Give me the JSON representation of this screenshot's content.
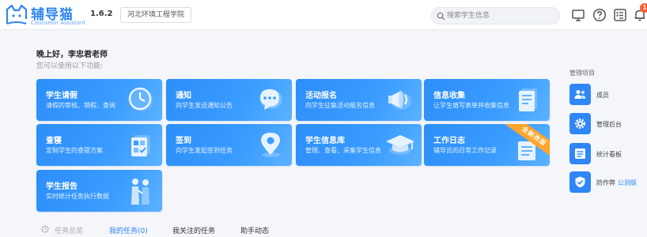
{
  "header": {
    "logo_title": "辅导猫",
    "logo_subtitle": "Counselor Assistant",
    "version": "1.6.2",
    "school": "河北环境工程学院",
    "search_placeholder": "搜索学生信息",
    "notification_count": "1"
  },
  "greeting": {
    "title": "晚上好，李忠君老师",
    "subtitle": "您可以使用以下功能:"
  },
  "cards": [
    {
      "title": "学生请假",
      "desc": "请假的审核、销假、查询",
      "icon": "clock-icon"
    },
    {
      "title": "通知",
      "desc": "向学生发送通知公告",
      "icon": "chat-bubble-icon"
    },
    {
      "title": "活动报名",
      "desc": "向学生征集活动报名信息",
      "icon": "megaphone-icon"
    },
    {
      "title": "信息收集",
      "desc": "让学生填写表单并收集信息",
      "icon": "form-icon"
    },
    {
      "title": "查寝",
      "desc": "定制学生的查寝方案",
      "icon": "dorm-check-icon"
    },
    {
      "title": "签到",
      "desc": "向学生发起签到任务",
      "icon": "location-pin-icon"
    },
    {
      "title": "学生信息库",
      "desc": "管理、查看、采集学生信息",
      "icon": "graduation-cap-icon"
    },
    {
      "title": "工作日志",
      "desc": "辅导员的日常工作记录",
      "icon": "notebook-icon",
      "ribbon": "全新改版"
    },
    {
      "title": "学生报告",
      "desc": "实时统计任务执行数据",
      "icon": "people-report-icon"
    }
  ],
  "right_panel": {
    "title": "管理项目",
    "items": [
      {
        "label": "成员",
        "icon": "members-icon"
      },
      {
        "label": "管理后台",
        "icon": "gear-icon"
      },
      {
        "label": "统计看板",
        "icon": "dashboard-icon"
      },
      {
        "label": "防作弊",
        "extra": "公测版",
        "icon": "shield-check-icon"
      }
    ]
  },
  "tabs": [
    {
      "label": "任务总览"
    },
    {
      "label": "我的任务(0)"
    },
    {
      "label": "我关注的任务"
    },
    {
      "label": "助手动态"
    }
  ],
  "colors": {
    "accent": "#2f86f6",
    "card_gradient_start": "#2c8ef8",
    "card_gradient_end": "#5cb2ff",
    "ribbon": "#ffa52b",
    "badge": "#ff5a2c"
  }
}
